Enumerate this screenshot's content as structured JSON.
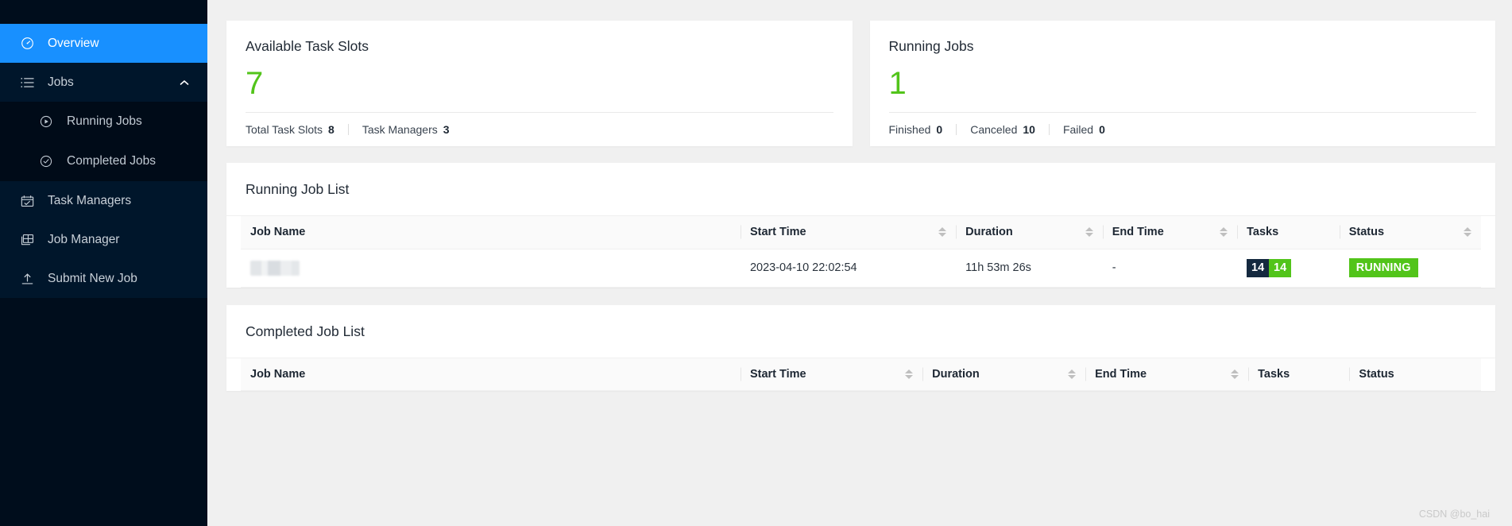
{
  "sidebar": {
    "items": [
      {
        "id": "overview",
        "label": "Overview",
        "icon": "dashboard-icon",
        "active": true
      },
      {
        "id": "jobs",
        "label": "Jobs",
        "icon": "list-icon",
        "active": false,
        "expanded": true,
        "toggle_icon": "chevron-up-icon"
      },
      {
        "id": "running-jobs",
        "label": "Running Jobs",
        "icon": "play-circle-icon",
        "active": false,
        "sub": true
      },
      {
        "id": "completed-jobs",
        "label": "Completed Jobs",
        "icon": "check-circle-icon",
        "active": false,
        "sub": true
      },
      {
        "id": "task-managers",
        "label": "Task Managers",
        "icon": "task-manager-icon",
        "active": false
      },
      {
        "id": "job-manager",
        "label": "Job Manager",
        "icon": "job-manager-icon",
        "active": false
      },
      {
        "id": "submit-new-job",
        "label": "Submit New Job",
        "icon": "upload-icon",
        "active": false
      }
    ]
  },
  "cards": {
    "available_task_slots": {
      "title": "Available Task Slots",
      "value": "7",
      "stats": [
        {
          "label": "Total Task Slots",
          "value": "8"
        },
        {
          "label": "Task Managers",
          "value": "3"
        }
      ]
    },
    "running_jobs": {
      "title": "Running Jobs",
      "value": "1",
      "stats": [
        {
          "label": "Finished",
          "value": "0"
        },
        {
          "label": "Canceled",
          "value": "10"
        },
        {
          "label": "Failed",
          "value": "0"
        }
      ]
    }
  },
  "running_job_list": {
    "title": "Running Job List",
    "columns": [
      {
        "key": "job_name",
        "label": "Job Name",
        "sortable": false
      },
      {
        "key": "start_time",
        "label": "Start Time",
        "sortable": true
      },
      {
        "key": "duration",
        "label": "Duration",
        "sortable": true
      },
      {
        "key": "end_time",
        "label": "End Time",
        "sortable": true
      },
      {
        "key": "tasks",
        "label": "Tasks",
        "sortable": false
      },
      {
        "key": "status",
        "label": "Status",
        "sortable": true
      }
    ],
    "rows": [
      {
        "job_name": "",
        "job_name_redacted": true,
        "start_time": "2023-04-10 22:02:54",
        "duration": "11h 53m 26s",
        "end_time": "-",
        "tasks": [
          {
            "value": "14",
            "color": "#14293f"
          },
          {
            "value": "14",
            "color": "#52c41a"
          }
        ],
        "status": "RUNNING",
        "status_color": "#52c41a"
      }
    ]
  },
  "completed_job_list": {
    "title": "Completed Job List",
    "columns": [
      {
        "key": "job_name",
        "label": "Job Name",
        "sortable": false
      },
      {
        "key": "start_time",
        "label": "Start Time",
        "sortable": true
      },
      {
        "key": "duration",
        "label": "Duration",
        "sortable": true
      },
      {
        "key": "end_time",
        "label": "End Time",
        "sortable": true
      },
      {
        "key": "tasks",
        "label": "Tasks",
        "sortable": false
      },
      {
        "key": "status",
        "label": "Status",
        "sortable": false
      }
    ],
    "rows": []
  },
  "watermark": "CSDN @bo_hai",
  "colors": {
    "sidebar_bg": "#000d1c",
    "sidebar_item_bg": "#00162b",
    "accent_blue": "#1890ff",
    "accent_green": "#52c41a",
    "dark_badge": "#14293f",
    "page_bg": "#f0f0f0"
  }
}
